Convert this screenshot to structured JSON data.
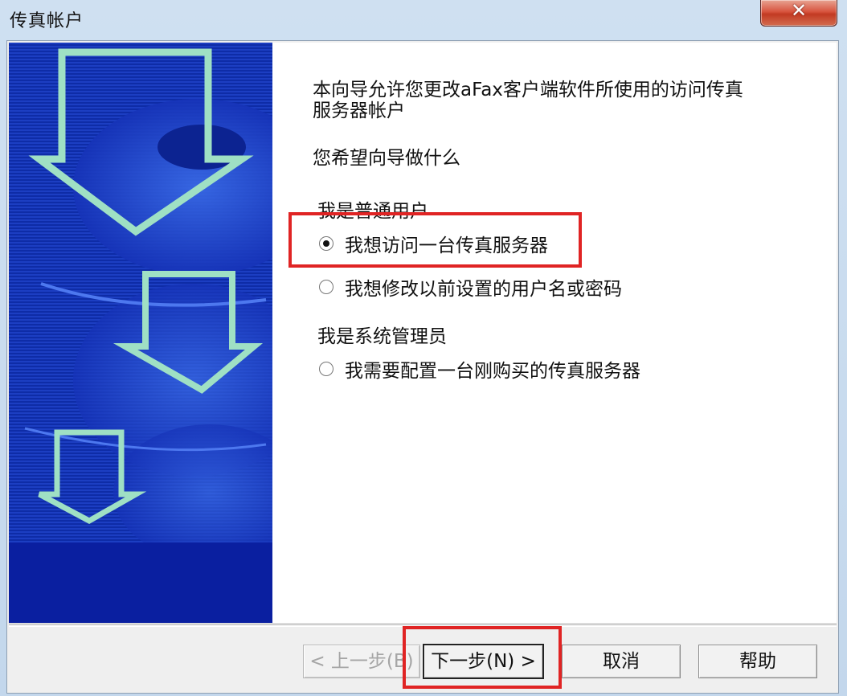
{
  "window": {
    "title": "传真帐户"
  },
  "wizard": {
    "intro": "本向导允许您更改aFax客户端软件所使用的访问传真服务器帐户",
    "intro_line1": "本向导允许您更改aFax客户端软件所使用的访问传真",
    "intro_line2": "服务器帐户",
    "question": "您希望向导做什么",
    "groups": [
      {
        "heading": "我是普通用户",
        "options": [
          {
            "label": "我想访问一台传真服务器",
            "selected": true
          },
          {
            "label": "我想修改以前设置的用户名或密码",
            "selected": false
          }
        ]
      },
      {
        "heading": "我是系统管理员",
        "options": [
          {
            "label": "我需要配置一台刚购买的传真服务器",
            "selected": false
          }
        ]
      }
    ]
  },
  "buttons": {
    "back": "< 上一步(B)",
    "next": "下一步(N) >",
    "cancel": "取消",
    "help": "帮助"
  },
  "colors": {
    "highlight": "#e02424",
    "side_panel": "#0e2ca7",
    "close_button": "#d8553f"
  },
  "icons": {
    "close": "close-icon",
    "decoration": "down-arrows-art"
  }
}
